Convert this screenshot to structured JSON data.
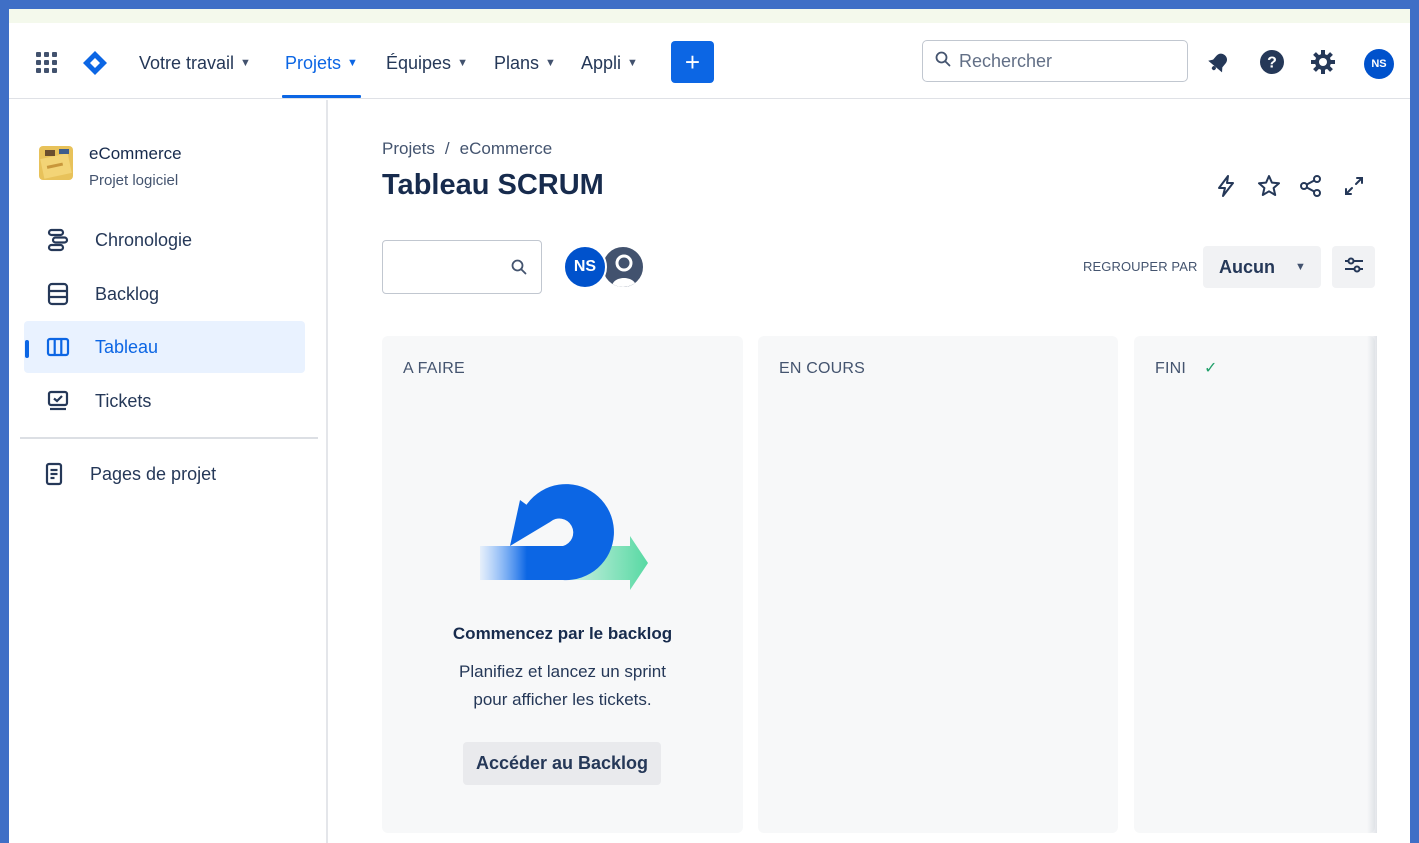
{
  "topnav": {
    "items": [
      {
        "label": "Votre travail"
      },
      {
        "label": "Projets"
      },
      {
        "label": "Équipes"
      },
      {
        "label": "Plans"
      },
      {
        "label": "Appli"
      }
    ],
    "active": "Projets",
    "create_label": "+",
    "search_placeholder": "Rechercher",
    "user_initials": "NS",
    "accent": "#0c66e4"
  },
  "sidebar": {
    "project_name": "eCommerce",
    "project_type": "Projet logiciel",
    "items": [
      {
        "label": "Chronologie",
        "icon": "timeline-icon"
      },
      {
        "label": "Backlog",
        "icon": "backlog-icon"
      },
      {
        "label": "Tableau",
        "icon": "board-icon",
        "selected": true
      },
      {
        "label": "Tickets",
        "icon": "issues-icon"
      }
    ],
    "pages_label": "Pages de projet"
  },
  "main": {
    "breadcrumb": [
      "Projets",
      "/",
      "eCommerce"
    ],
    "title": "Tableau SCRUM",
    "avatar_initials": "NS",
    "group_by_label": "REGROUPER PAR",
    "group_by_value": "Aucun",
    "columns": [
      {
        "title": "A FAIRE"
      },
      {
        "title": "EN COURS"
      },
      {
        "title": "FINI",
        "done_mark": "✓"
      }
    ],
    "empty_state": {
      "title": "Commencez par le backlog",
      "desc_line1": "Planifiez et lancez un sprint",
      "desc_line2": "pour afficher les tickets.",
      "button": "Accéder au Backlog"
    }
  }
}
